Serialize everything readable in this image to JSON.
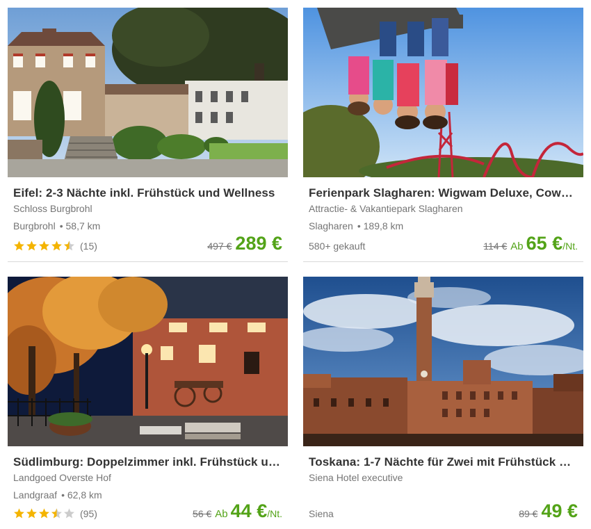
{
  "deals": [
    {
      "title": "Eifel: 2-3 Nächte inkl. Frühstück und Wellness",
      "merchant": "Schloss Burgbrohl",
      "city": "Burgbrohl",
      "distance": "• 58,7 km",
      "rating": 4.5,
      "reviews": "(15)",
      "bought": "",
      "old_price": "497 €",
      "ab": "",
      "price": "289 €",
      "per": "",
      "image": "castle-hotel-garden-photo"
    },
    {
      "title": "Ferienpark Slagharen: Wigwam Deluxe, Cowb…",
      "merchant": "Attractie- & Vakantiepark Slagharen",
      "city": "Slagharen",
      "distance": "• 189,8 km",
      "rating": null,
      "reviews": "",
      "bought": "580+ gekauft",
      "old_price": "114 €",
      "ab": "Ab",
      "price": "65 €",
      "per": "/Nt.",
      "image": "rollercoaster-riders-photo"
    },
    {
      "title": "Südlimburg: Doppelzimmer inkl. Frühstück un…",
      "merchant": "Landgoed Overste Hof",
      "city": "Landgraaf",
      "distance": "• 62,8 km",
      "rating": 3.5,
      "reviews": "(95)",
      "bought": "",
      "old_price": "56 €",
      "ab": "Ab",
      "price": "44 €",
      "per": "/Nt.",
      "image": "farmhouse-courtyard-night-photo"
    },
    {
      "title": "Toskana: 1-7 Nächte für Zwei mit Frühstück o…",
      "merchant": "Siena Hotel executive",
      "city": "Siena",
      "distance": "",
      "rating": null,
      "reviews": "",
      "bought": "",
      "old_price": "89 €",
      "ab": "",
      "price": "49 €",
      "per": "",
      "image": "siena-piazza-tower-photo"
    }
  ],
  "colors": {
    "price_green": "#53a318",
    "star_gold": "#f4b400",
    "star_empty": "#cccccc",
    "text_dark": "#333333",
    "text_muted": "#757575"
  },
  "icons": {
    "star_full": "star-icon",
    "star_half": "star-half-icon",
    "star_empty": "star-empty-icon"
  }
}
